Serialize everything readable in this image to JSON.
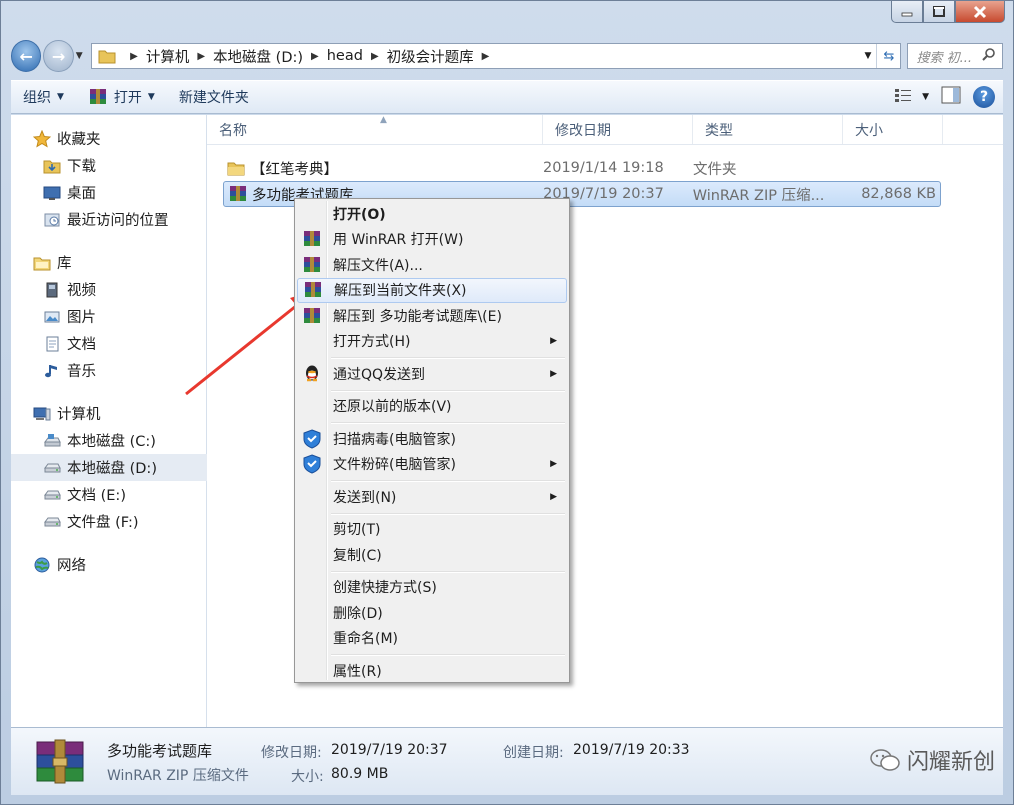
{
  "breadcrumb": [
    "计算机",
    "本地磁盘 (D:)",
    "head",
    "初级会计题库"
  ],
  "search": {
    "placeholder": "搜索 初..."
  },
  "toolbar": {
    "organize": "组织",
    "open": "打开",
    "new_folder": "新建文件夹"
  },
  "nav": {
    "favorites": {
      "label": "收藏夹",
      "items": [
        "下载",
        "桌面",
        "最近访问的位置"
      ]
    },
    "libraries": {
      "label": "库",
      "items": [
        "视频",
        "图片",
        "文档",
        "音乐"
      ]
    },
    "computer": {
      "label": "计算机",
      "items": [
        "本地磁盘 (C:)",
        "本地磁盘 (D:)",
        "文档 (E:)",
        "文件盘 (F:)"
      ]
    },
    "network": {
      "label": "网络"
    }
  },
  "columns": {
    "name": "名称",
    "date": "修改日期",
    "type": "类型",
    "size": "大小"
  },
  "files": [
    {
      "name": "【红笔考典】",
      "date": "2019/1/14 19:18",
      "type": "文件夹",
      "size": ""
    },
    {
      "name": "多功能考试题库",
      "date": "2019/7/19 20:37",
      "type": "WinRAR ZIP 压缩...",
      "size": "82,868 KB"
    }
  ],
  "context_menu": {
    "open": "打开(O)",
    "winrar_open": "用 WinRAR 打开(W)",
    "extract": "解压文件(A)...",
    "extract_here": "解压到当前文件夹(X)",
    "extract_to": "解压到 多功能考试题库\\(E)",
    "open_with": "打开方式(H)",
    "send_qq": "通过QQ发送到",
    "restore": "还原以前的版本(V)",
    "scan": "扫描病毒(电脑管家)",
    "shred": "文件粉碎(电脑管家)",
    "send_to": "发送到(N)",
    "cut": "剪切(T)",
    "copy": "复制(C)",
    "shortcut": "创建快捷方式(S)",
    "delete": "删除(D)",
    "rename": "重命名(M)",
    "properties": "属性(R)"
  },
  "details": {
    "name": "多功能考试题库",
    "type": "WinRAR ZIP 压缩文件",
    "modified_label": "修改日期:",
    "modified": "2019/7/19 20:37",
    "created_label": "创建日期:",
    "created": "2019/7/19 20:33",
    "size_label": "大小:",
    "size": "80.9 MB"
  },
  "watermark": "闪耀新创",
  "colors": {
    "accent": "#2d6ab0",
    "selection": "#c4dcf7",
    "annotation": "#e8382e"
  }
}
